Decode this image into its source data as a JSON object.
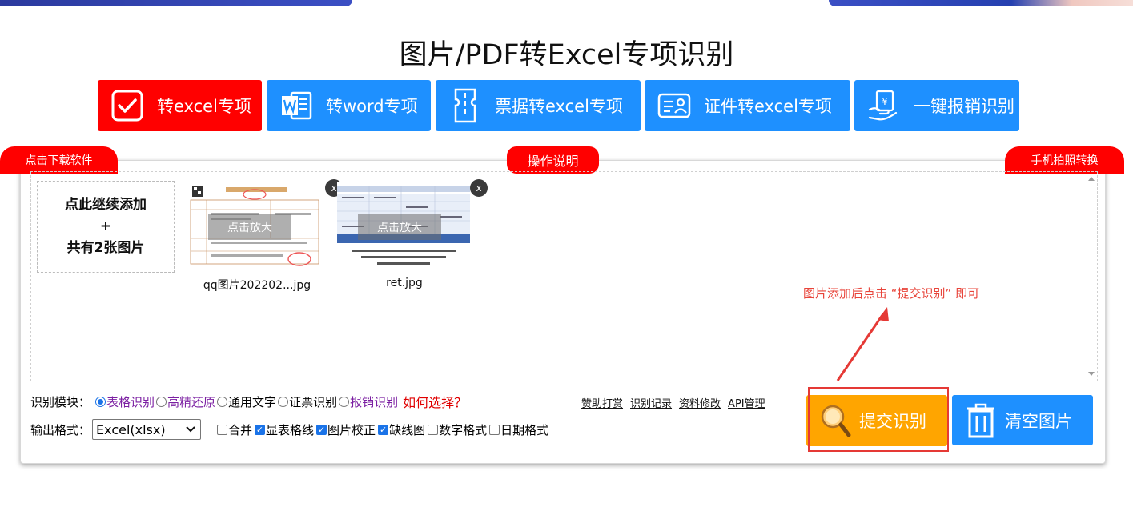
{
  "page": {
    "title": "图片/PDF转Excel专项识别"
  },
  "tabs": [
    {
      "label": "转excel专项",
      "icon": "checkbox-icon",
      "active": true
    },
    {
      "label": "转word专项",
      "icon": "word-icon",
      "active": false
    },
    {
      "label": "票据转excel专项",
      "icon": "receipt-icon",
      "active": false
    },
    {
      "label": "证件转excel专项",
      "icon": "id-card-icon",
      "active": false
    },
    {
      "label": "一键报销识别",
      "icon": "reimburse-icon",
      "active": false
    }
  ],
  "pills": {
    "download": "点击下载软件",
    "instructions": "操作说明",
    "mobile": "手机拍照转换"
  },
  "upload": {
    "add_line1": "点此继续添加",
    "add_line2": "+",
    "add_line3": "共有2张图片",
    "files": [
      {
        "name": "qq图片202202...jpg",
        "zoom_label": "点击放大",
        "close": "x"
      },
      {
        "name": "ret.jpg",
        "zoom_label": "点击放大",
        "close": "x"
      }
    ],
    "hint": "图片添加后点击 “提交识别” 即可"
  },
  "options": {
    "module_label": "识别模块：",
    "modules": [
      {
        "label": "表格识别",
        "selected": true,
        "color": "#7b1fa2"
      },
      {
        "label": "高精还原",
        "selected": false,
        "color": "#7b1fa2"
      },
      {
        "label": "通用文字",
        "selected": false,
        "color": "#111111"
      },
      {
        "label": "证票识别",
        "selected": false,
        "color": "#111111"
      },
      {
        "label": "报销识别",
        "selected": false,
        "color": "#7b1fa2"
      }
    ],
    "help_link": "如何选择？",
    "format_label": "输出格式：",
    "format_value": "Excel(xlsx)",
    "checks": [
      {
        "label": "合并",
        "checked": false
      },
      {
        "label": "显表格线",
        "checked": true
      },
      {
        "label": "图片校正",
        "checked": true
      },
      {
        "label": "缺线图",
        "checked": true
      },
      {
        "label": "数字格式",
        "checked": false
      },
      {
        "label": "日期格式",
        "checked": false
      }
    ],
    "links": [
      "赞助打赏",
      "识别记录",
      "资料修改",
      "API管理"
    ]
  },
  "actions": {
    "submit": "提交识别",
    "clear": "清空图片"
  },
  "colors": {
    "accent_blue": "#1e90ff",
    "accent_red": "#ff0000",
    "submit_orange": "#ffa500"
  }
}
